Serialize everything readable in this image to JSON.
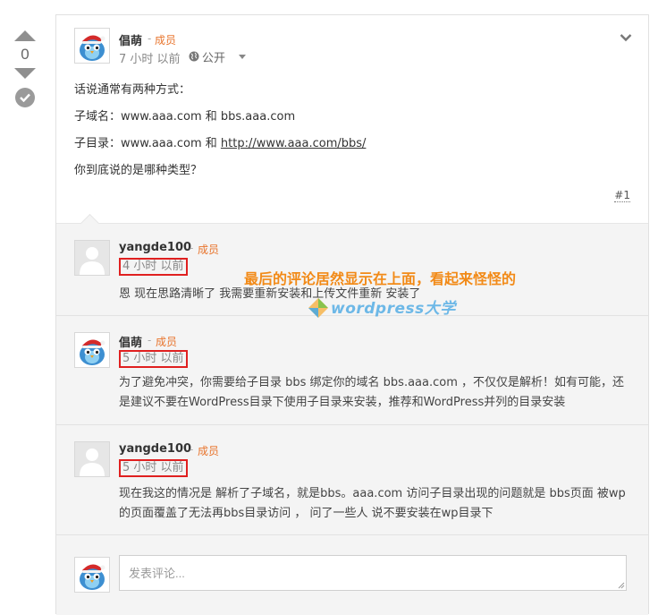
{
  "vote": {
    "count": "0"
  },
  "question": {
    "author": "倡萌",
    "role_sep": "-",
    "role": "成员",
    "time": "7 小时 以前",
    "visibility": "公开",
    "lines": [
      "话说通常有两种方式：",
      "子域名：www.aaa.com  和 bbs.aaa.com",
      "子目录：www.aaa.com 和 ",
      "你到底说的是哪种类型？"
    ],
    "link_text": "http://www.aaa.com/bbs/",
    "permalink": "#1"
  },
  "annotation": "最后的评论居然显示在上面，看起来怪怪的",
  "watermark": "wordpress大学",
  "replies": [
    {
      "author": "yangde100",
      "role_sep": "-",
      "role": "成员",
      "time": "4 小时 以前",
      "text": "恩 现在思路清晰了 我需要重新安装和上传文件重新 安装了"
    },
    {
      "author": "倡萌",
      "role_sep": "-",
      "role": "成员",
      "time": "5 小时 以前",
      "text": "为了避免冲突，你需要给子目录 bbs 绑定你的域名 bbs.aaa.com ，不仅仅是解析！如有可能，还是建议不要在WordPress目录下使用子目录来安装，推荐和WordPress并列的目录安装"
    },
    {
      "author": "yangde100",
      "role_sep": "-",
      "role": "成员",
      "time": "5 小时 以前",
      "text": "现在我这的情况是 解析了子域名，就是bbs。aaa.com 访问子目录出现的问题就是 bbs页面 被wp的页面覆盖了无法再bbs目录访问 ， 问了一些人 说不要安装在wp目录下"
    }
  ],
  "compose": {
    "placeholder": "发表评论..."
  },
  "colors": {
    "accent_role": "#e8742c",
    "annotation": "#f28a17",
    "highlight_box": "#e02020",
    "reply_bg": "#f4f4f4"
  },
  "icons": [
    "upvote-icon",
    "downvote-icon",
    "accept-check-icon",
    "globe-icon",
    "chevron-down-icon",
    "bird-avatar-icon",
    "default-user-icon"
  ]
}
